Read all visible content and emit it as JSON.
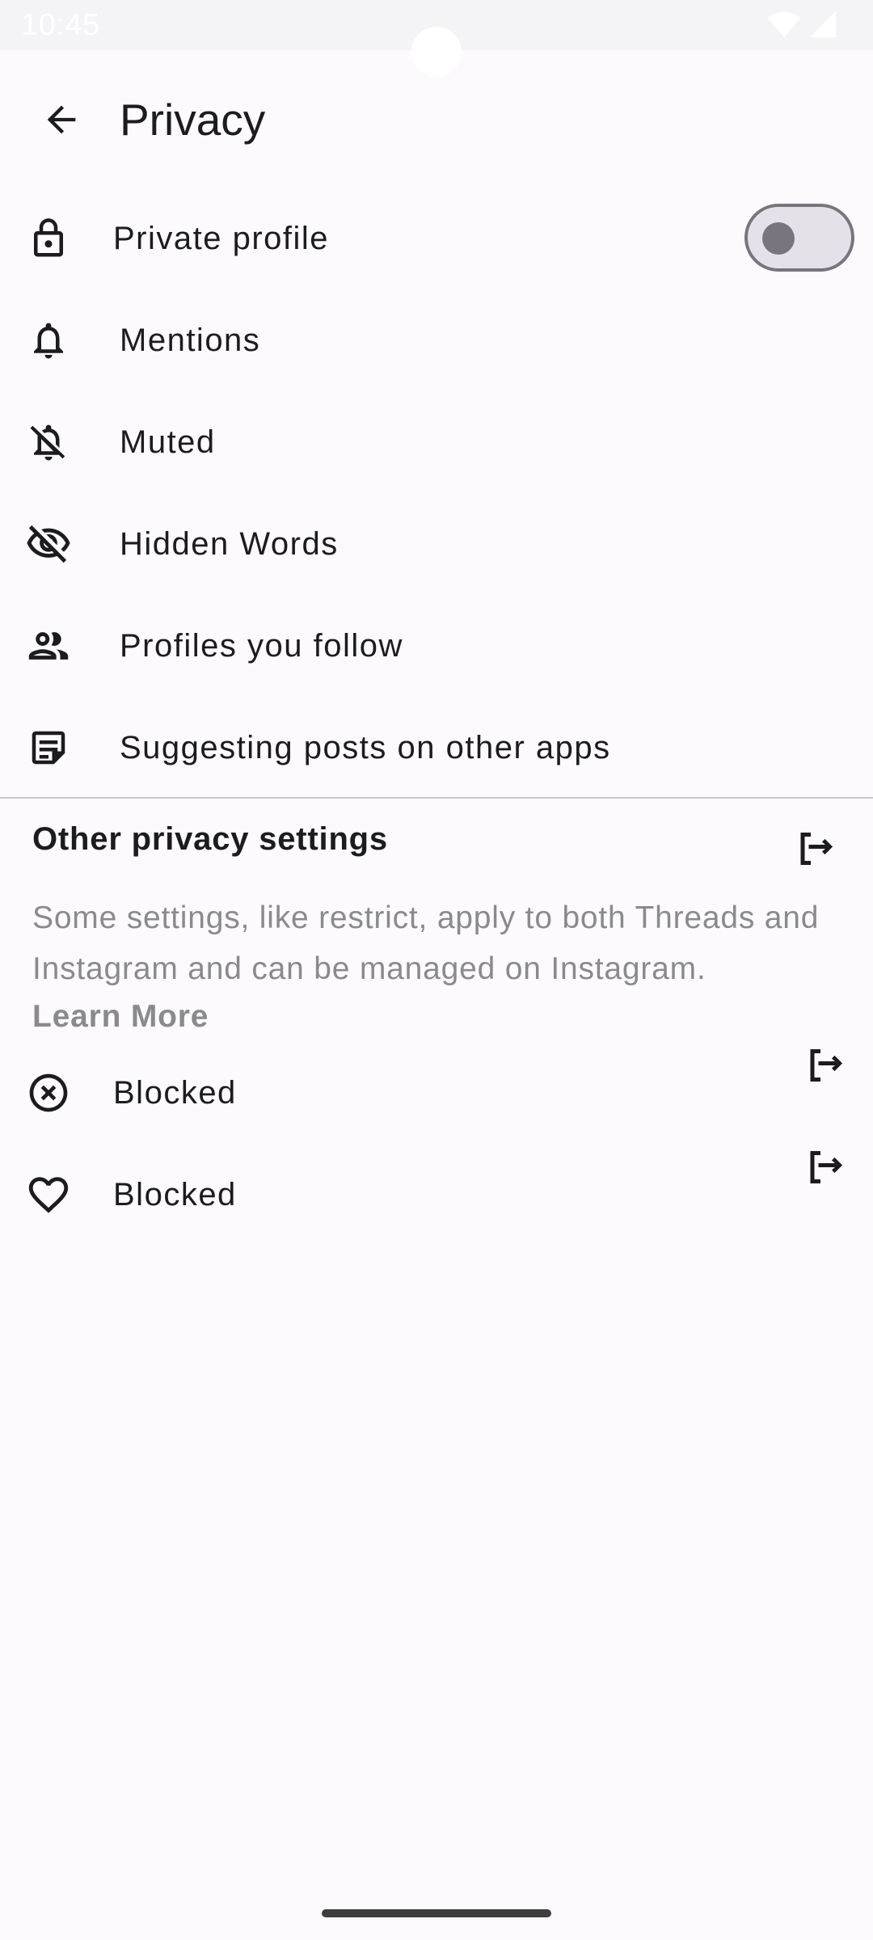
{
  "status_bar": {
    "time": "10:45",
    "icons": [
      "wifi-icon",
      "signal-icon"
    ]
  },
  "app_bar": {
    "back_icon": "arrow-back-icon",
    "title": "Privacy"
  },
  "settings": [
    {
      "icon": "lock-icon",
      "label": "Private profile",
      "toggle": {
        "on": false
      }
    },
    {
      "icon": "bell-icon",
      "label": "Mentions"
    },
    {
      "icon": "bell-off-icon",
      "label": "Muted"
    },
    {
      "icon": "eye-off-icon",
      "label": "Hidden Words"
    },
    {
      "icon": "people-icon",
      "label": "Profiles you follow"
    },
    {
      "icon": "notes-icon",
      "label": "Suggesting posts on other apps"
    }
  ],
  "other_section": {
    "title": "Other privacy settings",
    "exit_icon": "exit-icon",
    "description": "Some settings, like restrict, apply to both Threads and Instagram and can be managed on Instagram.",
    "learn_more": "Learn More",
    "items": [
      {
        "icon": "x-circle-icon",
        "label": "Blocked",
        "trailing_icon": "exit-icon"
      },
      {
        "icon": "heart-icon",
        "label": "Blocked",
        "trailing_icon": "exit-icon"
      }
    ]
  },
  "colors": {
    "background": "#fcfafc",
    "text_primary": "#1c1b1f",
    "text_secondary": "#8a8a8d",
    "toggle_track": "#e6e1e9",
    "toggle_outline": "#79747e"
  }
}
